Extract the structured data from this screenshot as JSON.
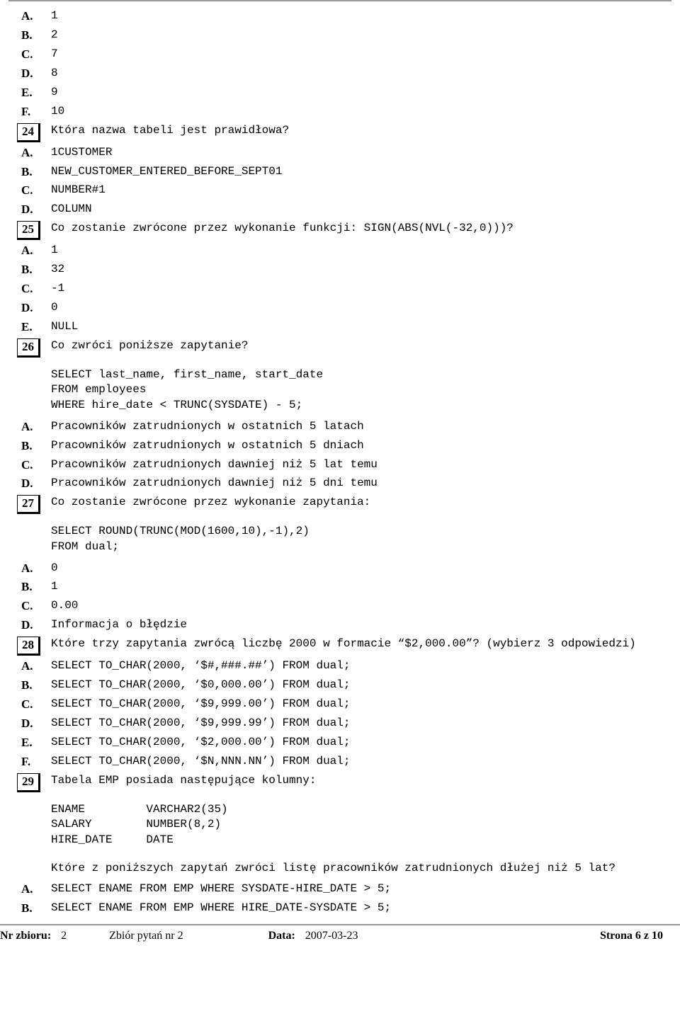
{
  "q23_tail": {
    "A": "1",
    "B": "2",
    "C": "7",
    "D": "8",
    "E": "9",
    "F": "10"
  },
  "q24": {
    "num": "24",
    "q": "Która nazwa tabeli jest prawidłowa?",
    "A": "1CUSTOMER",
    "B": "NEW_CUSTOMER_ENTERED_BEFORE_SEPT01",
    "C": "NUMBER#1",
    "D": "COLUMN"
  },
  "q25": {
    "num": "25",
    "q": "Co zostanie zwrócone przez wykonanie funkcji: SIGN(ABS(NVL(-32,0)))?",
    "A": "1",
    "B": "32",
    "C": "-1",
    "D": "0",
    "E": "NULL"
  },
  "q26": {
    "num": "26",
    "q": "Co zwróci poniższe zapytanie?",
    "code": "SELECT last_name, first_name, start_date\nFROM employees\nWHERE hire_date < TRUNC(SYSDATE) - 5;",
    "A": "Pracowników zatrudnionych w ostatnich 5 latach",
    "B": "Pracowników zatrudnionych w ostatnich 5 dniach",
    "C": "Pracowników zatrudnionych dawniej niż 5 lat temu",
    "D": "Pracowników zatrudnionych dawniej niż 5 dni temu"
  },
  "q27": {
    "num": "27",
    "q": "Co zostanie zwrócone przez wykonanie zapytania:",
    "code": "SELECT ROUND(TRUNC(MOD(1600,10),-1),2)\nFROM dual;",
    "A": "0",
    "B": "1",
    "C": "0.00",
    "D": "Informacja o błędzie"
  },
  "q28": {
    "num": "28",
    "q": "Które trzy zapytania zwrócą liczbę 2000 w formacie “$2,000.00”? (wybierz 3 odpowiedzi)",
    "A": "SELECT TO_CHAR(2000, ‘$#,###.##’) FROM dual;",
    "B": "SELECT TO_CHAR(2000, ‘$0,000.00’) FROM dual;",
    "C": "SELECT TO_CHAR(2000, ‘$9,999.00’) FROM dual;",
    "D": "SELECT TO_CHAR(2000, ‘$9,999.99’) FROM dual;",
    "E": "SELECT TO_CHAR(2000, ‘$2,000.00’) FROM dual;",
    "F": "SELECT TO_CHAR(2000, ‘$N,NNN.NN’) FROM dual;"
  },
  "q29": {
    "num": "29",
    "q": "Tabela EMP posiada następujące kolumny:",
    "cols": "ENAME         VARCHAR2(35)\nSALARY        NUMBER(8,2)\nHIRE_DATE     DATE",
    "q2": "Które z poniższych zapytań zwróci listę pracowników zatrudnionych dłużej niż 5 lat?",
    "A": "SELECT ENAME FROM EMP WHERE SYSDATE-HIRE_DATE > 5;",
    "B": "SELECT ENAME FROM EMP WHERE HIRE_DATE-SYSDATE > 5;"
  },
  "footer": {
    "nr_zbioru_label": "Nr zbioru:",
    "nr_zbioru_value": "2",
    "zbior_label": "Zbiór pytań nr 2",
    "data_label": "Data:",
    "data_value": "2007-03-23",
    "page_label": "Strona 6 z 10"
  }
}
